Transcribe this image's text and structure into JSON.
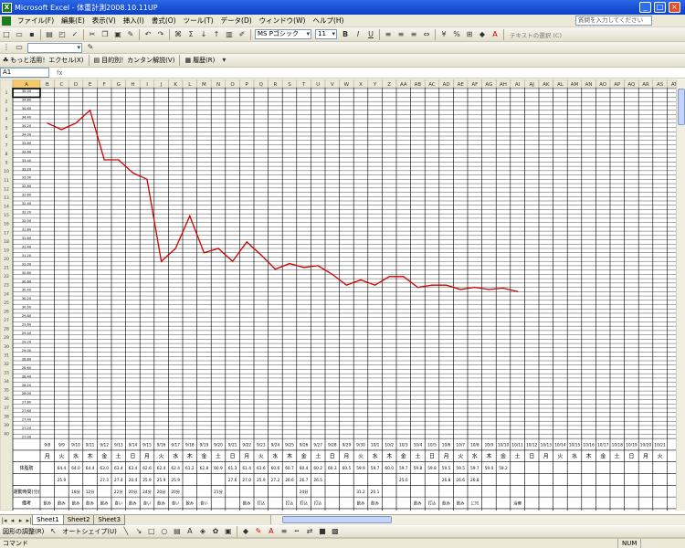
{
  "window": {
    "title": "Microsoft Excel - 体重計測2008.10.11UP"
  },
  "menu": {
    "items": [
      "ファイル(F)",
      "編集(E)",
      "表示(V)",
      "挿入(I)",
      "書式(O)",
      "ツール(T)",
      "データ(D)",
      "ウィンドウ(W)",
      "ヘルプ(H)"
    ],
    "help_placeholder": "質問を入力してください"
  },
  "format_toolbar": {
    "font": "MS Pゴシック",
    "size": "11",
    "bold": "B",
    "italic": "I",
    "underline": "U",
    "hint": "テキストの選択 (C)"
  },
  "link_toolbar": {
    "btn1": "もっと活用！エクセル(X)",
    "btn2": "目的別！カンタン解説(V)",
    "btn3": "履歴(R)"
  },
  "formula_bar": {
    "name_box": "A1",
    "fx": "fx",
    "value": ""
  },
  "columns": [
    "A",
    "B",
    "C",
    "D",
    "E",
    "F",
    "G",
    "H",
    "I",
    "J",
    "K",
    "L",
    "M",
    "N",
    "O",
    "P",
    "Q",
    "R",
    "S",
    "T",
    "U",
    "V",
    "W",
    "X",
    "Y",
    "Z",
    "AA",
    "AB",
    "AC",
    "AD",
    "AE",
    "AF",
    "AG",
    "AH",
    "AI",
    "AJ",
    "AK",
    "AL",
    "AM",
    "AN",
    "AO",
    "AP",
    "AQ",
    "AR",
    "AS",
    "AT"
  ],
  "row_numbers": [
    "1",
    "2",
    "3",
    "4",
    "5",
    "6",
    "7",
    "8",
    "9",
    "10",
    "11",
    "12",
    "13",
    "14",
    "15",
    "16",
    "17",
    "18",
    "19",
    "20",
    "21",
    "22",
    "23",
    "24",
    "25",
    "26",
    "27",
    "28",
    "29",
    "30",
    "31",
    "32",
    "33",
    "34",
    "35",
    "36",
    "37",
    "38",
    "39",
    "40",
    "41",
    "42",
    "43",
    "44",
    "45",
    "46",
    "47",
    "48",
    "49"
  ],
  "y_axis_labels": [
    "35.00",
    "34.90",
    "34.80",
    "34.70",
    "34.60",
    "34.50",
    "34.40",
    "34.30",
    "34.20",
    "34.10",
    "34.00",
    "33.90",
    "33.80",
    "33.70",
    "33.60",
    "33.50",
    "33.40",
    "33.30",
    "33.20",
    "33.10",
    "33.00",
    "32.90",
    "32.80",
    "32.70",
    "32.60",
    "32.50",
    "32.40",
    "32.30",
    "32.20",
    "32.10",
    "32.00",
    "31.90",
    "31.80",
    "31.70",
    "31.60",
    "31.50",
    "31.40",
    "31.30",
    "31.20",
    "31.10",
    "31.00",
    "30.90",
    "30.80",
    "30.70",
    "30.60",
    "30.50",
    "30.40",
    "30.30",
    "30.20",
    "30.10",
    "30.00",
    "29.90",
    "29.80",
    "29.70",
    "29.60",
    "29.50",
    "29.40",
    "29.30",
    "29.20",
    "29.10",
    "29.00",
    "28.90",
    "28.80",
    "28.70",
    "28.60",
    "28.50",
    "28.40",
    "28.30",
    "28.20",
    "28.10",
    "28.00",
    "27.90",
    "27.80",
    "27.70",
    "27.60",
    "27.50",
    "27.40",
    "27.30",
    "27.20",
    "27.10",
    "27.00"
  ],
  "row_labels": [
    "",
    "",
    "体脂肪",
    "",
    "運動時間(分)",
    "備考"
  ],
  "dates": [
    "9/8",
    "9/9",
    "9/10",
    "9/11",
    "9/12",
    "9/13",
    "9/14",
    "9/15",
    "9/16",
    "9/17",
    "9/18",
    "9/19",
    "9/20",
    "9/21",
    "9/22",
    "9/23",
    "9/24",
    "9/25",
    "9/26",
    "9/27",
    "9/28",
    "9/29",
    "9/30",
    "10/1",
    "10/2",
    "10/3",
    "10/4",
    "10/5",
    "10/6",
    "10/7",
    "10/8",
    "10/9",
    "10/10",
    "10/11",
    "10/12",
    "10/13",
    "10/14",
    "10/15",
    "10/16",
    "10/17",
    "10/18",
    "10/19",
    "10/20",
    "10/21",
    "10/22",
    "10/23"
  ],
  "weekdays": [
    "月",
    "火",
    "水",
    "木",
    "金",
    "土",
    "日",
    "月",
    "火",
    "水",
    "木",
    "金",
    "土",
    "日",
    "月",
    "火",
    "水",
    "木",
    "金",
    "土",
    "日",
    "月",
    "火",
    "水",
    "木",
    "金",
    "土",
    "日",
    "月",
    "火",
    "水",
    "木",
    "金",
    "土",
    "日",
    "月",
    "火",
    "水",
    "木",
    "金",
    "土",
    "日",
    "月",
    "火",
    "水",
    "木"
  ],
  "weight_row": [
    "",
    "64.4",
    "64.0",
    "64.4",
    "63.0",
    "63.4",
    "63.4",
    "62.6",
    "62.4",
    "62.4",
    "61.2",
    "62.8",
    "60.9",
    "61.3",
    "61.4",
    "61.6",
    "60.6",
    "60.7",
    "60.4",
    "60.2",
    "60.3",
    "60.5",
    "59.9",
    "59.7",
    "60.0",
    "59.7",
    "59.8",
    "59.8",
    "59.5",
    "59.5",
    "59.7",
    "59.0",
    "59.2",
    "",
    "",
    "",
    "",
    "",
    "",
    "",
    "",
    "",
    "",
    "",
    "",
    ""
  ],
  "body_fat_row": [
    "",
    "25.9",
    "",
    "",
    "27.3",
    "27.4",
    "20.4",
    "25.9",
    "25.9",
    "25.9",
    "",
    "",
    "",
    "27.6",
    "27.0",
    "25.9",
    "27.2",
    "26.6",
    "26.7",
    "26.5",
    "",
    "",
    "",
    "",
    "",
    "25.0",
    "",
    "",
    "26.8",
    "26.6",
    "26.8",
    "",
    "",
    "",
    "",
    "",
    "",
    "",
    "",
    "",
    "",
    "",
    "",
    "",
    "",
    ""
  ],
  "exercise_row": [
    "",
    "",
    "18分",
    "12分",
    "",
    "22分",
    "20分",
    "24分",
    "20分",
    "20分",
    "",
    "",
    "21分",
    "",
    "",
    "",
    "",
    "",
    "24分",
    "",
    "",
    "",
    "31.2",
    "20.1",
    "",
    "",
    "",
    "",
    "",
    "",
    "",
    "",
    "",
    "",
    "",
    "",
    "",
    "",
    "",
    "",
    "",
    "",
    "",
    "",
    "",
    ""
  ],
  "notes_row": [
    "",
    "",
    "",
    "",
    "",
    "",
    "",
    "",
    "",
    "",
    "",
    "",
    "",
    "",
    "",
    "",
    "",
    "",
    "",
    "",
    "",
    "",
    "",
    "",
    "",
    "",
    "",
    "",
    "",
    "",
    "",
    "",
    "",
    "",
    "",
    "",
    "",
    "",
    "",
    "",
    "",
    "",
    "",
    "",
    "",
    ""
  ],
  "notes_text": [
    "飲み",
    "飲み",
    "飲み",
    "飲み",
    "飲み",
    "食い",
    "飲み",
    "食い",
    "飲み",
    "食い",
    "飲み",
    "食い",
    "",
    "",
    "飲み",
    "打込",
    "",
    "打込",
    "打込",
    "打込",
    "",
    "",
    "飲み",
    "飲み",
    "",
    "",
    "飲み",
    "打込",
    "飲み",
    "飲み",
    "ﾕﾆｸﾛ",
    "",
    "",
    "治療",
    "",
    "",
    ""
  ],
  "sheets": {
    "tabs": [
      "Sheet1",
      "Sheet2",
      "Sheet3"
    ]
  },
  "draw_toolbar": {
    "label1": "図形の調整(R)",
    "label2": "オートシェイプ(U)"
  },
  "status": {
    "left": "コマンド",
    "num": "NUM"
  },
  "chart_data": {
    "type": "line",
    "title": "",
    "xlabel": "",
    "ylabel": "",
    "ylim": [
      27.0,
      35.0
    ],
    "color": "#cc0000",
    "x": [
      "9/8",
      "9/9",
      "9/10",
      "9/11",
      "9/12",
      "9/13",
      "9/14",
      "9/15",
      "9/16",
      "9/17",
      "9/18",
      "9/19",
      "9/20",
      "9/21",
      "9/22",
      "9/23",
      "9/24",
      "9/25",
      "9/26",
      "9/27",
      "9/28",
      "9/29",
      "9/30",
      "10/1",
      "10/2",
      "10/3",
      "10/4",
      "10/5",
      "10/6",
      "10/7",
      "10/8",
      "10/9",
      "10/10",
      "10/11"
    ],
    "y": [
      34.2,
      34.05,
      34.2,
      34.5,
      33.35,
      33.35,
      33.05,
      32.9,
      31.0,
      31.3,
      32.05,
      31.2,
      31.3,
      31.0,
      31.45,
      31.15,
      30.82,
      30.95,
      30.86,
      30.9,
      30.7,
      30.45,
      30.57,
      30.45,
      30.65,
      30.65,
      30.4,
      30.45,
      30.45,
      30.35,
      30.4,
      30.35,
      30.38,
      30.3
    ]
  }
}
